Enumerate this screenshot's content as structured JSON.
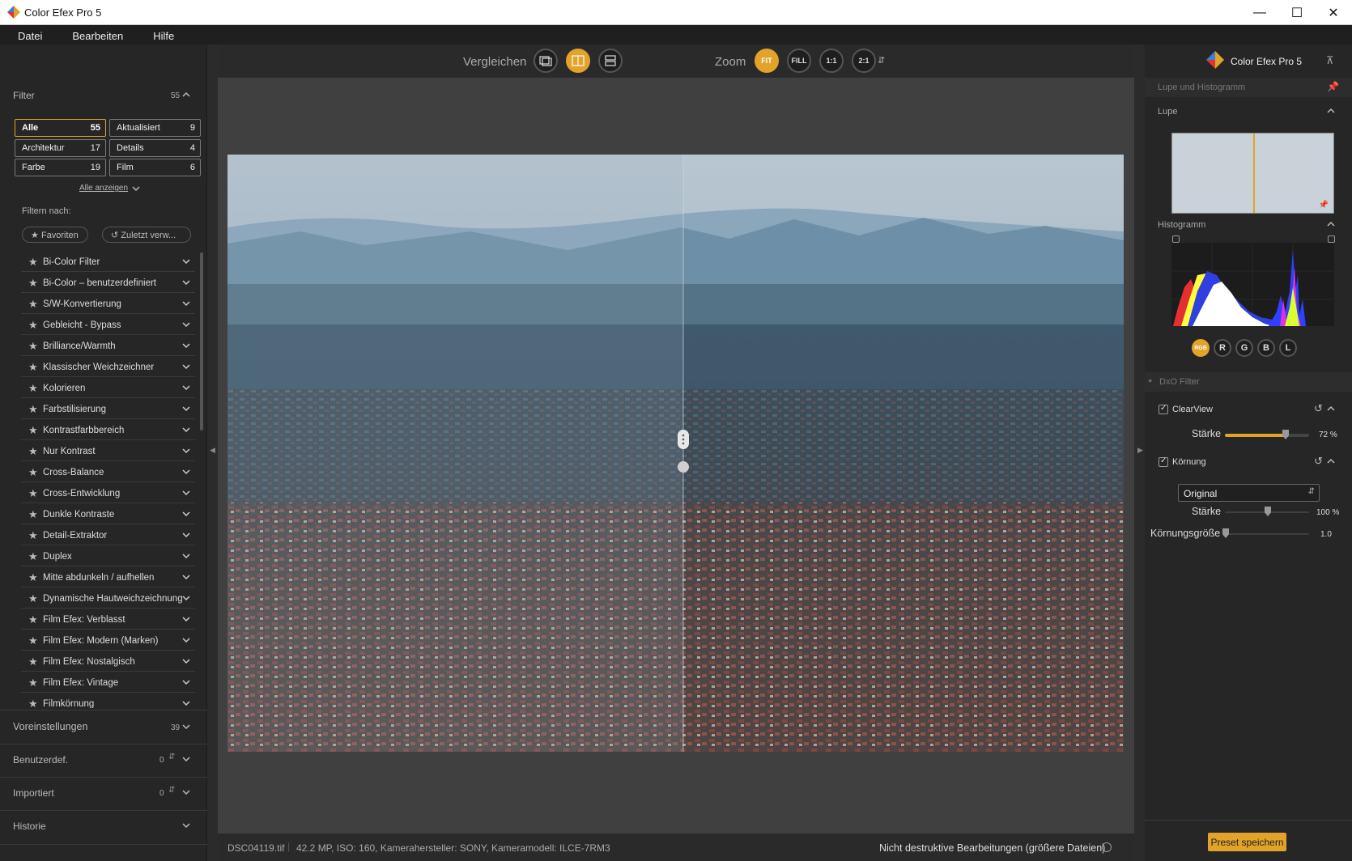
{
  "window": {
    "title": "Color Efex Pro 5"
  },
  "menu": [
    "Datei",
    "Bearbeiten",
    "Hilfe"
  ],
  "left": {
    "filter_header": "Filter",
    "filter_count": "55",
    "categories": [
      {
        "label": "Alle",
        "count": "55",
        "active": true
      },
      {
        "label": "Aktualisiert",
        "count": "9"
      },
      {
        "label": "Architektur",
        "count": "17"
      },
      {
        "label": "Details",
        "count": "4"
      },
      {
        "label": "Farbe",
        "count": "19"
      },
      {
        "label": "Film",
        "count": "6"
      }
    ],
    "show_all": "Alle anzeigen",
    "filter_by": "Filtern nach:",
    "favorites": "Favoriten",
    "recent": "Zuletzt verw...",
    "filters": [
      "Bi-Color Filter",
      "Bi-Color – benutzerdefiniert",
      "S/W-Konvertierung",
      "Gebleicht - Bypass",
      "Brilliance/Warmth",
      "Klassischer Weichzeichner",
      "Kolorieren",
      "Farbstilisierung",
      "Kontrastfarbbereich",
      "Nur Kontrast",
      "Cross-Balance",
      "Cross-Entwicklung",
      "Dunkle Kontraste",
      "Detail-Extraktor",
      "Duplex",
      "Mitte abdunkeln / aufhellen",
      "Dynamische Hautweichzeichnung",
      "Film Efex: Verblasst",
      "Film Efex: Modern (Marken)",
      "Film Efex: Nostalgisch",
      "Film Efex: Vintage",
      "Filmkörnung"
    ],
    "presets": {
      "label": "Voreinstellungen",
      "count": "39"
    },
    "custom": {
      "label": "Benutzerdef.",
      "count": "0"
    },
    "imported": {
      "label": "Importiert",
      "count": "0"
    },
    "history": {
      "label": "Historie"
    }
  },
  "toolbar": {
    "compare_label": "Vergleichen",
    "zoom_label": "Zoom",
    "zoom_fit": "FIT",
    "zoom_fill": "FILL",
    "zoom_1_1": "1:1",
    "zoom_2_1": "2:1"
  },
  "status": {
    "filename": "DSC04119.tif",
    "meta": "42.2 MP, ISO: 160, Kamerahersteller: SONY, Kameramodell: ILCE-7RM3",
    "nondestructive": "Nicht destruktive Bearbeitungen (größere Dateien)"
  },
  "right": {
    "brand": "Color Efex Pro 5",
    "loupe_hist_header": "Lupe und Histogramm",
    "loupe_label": "Lupe",
    "histogram_label": "Histogramm",
    "channels": [
      "RGB",
      "R",
      "G",
      "B",
      "L"
    ],
    "dxo_filter": "DxO Filter",
    "clearview": {
      "label": "ClearView",
      "strength_label": "Stärke",
      "strength_value": "72 %",
      "level": 0.72
    },
    "grain": {
      "label": "Körnung",
      "mode": "Original",
      "strength_label": "Stärke",
      "strength_value": "100 %",
      "size_label": "Körnungsgröße",
      "size_value": "1.0"
    },
    "save_preset": "Preset speichern"
  },
  "colors": {
    "accent": "#e2a32a",
    "panel": "#262626",
    "canvas": "#404040"
  }
}
